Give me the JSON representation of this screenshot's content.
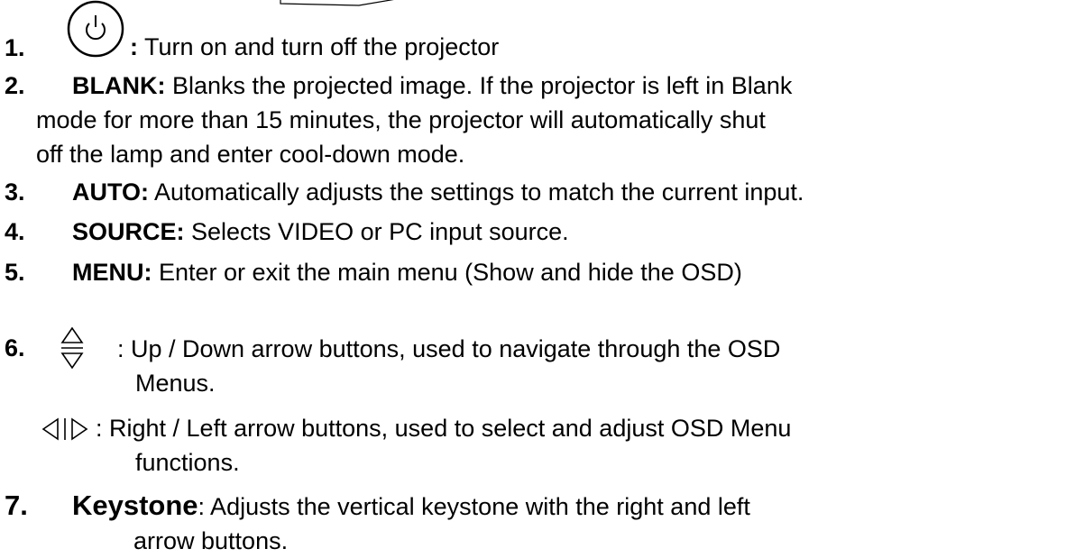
{
  "items": [
    {
      "num": "1.",
      "term": ":",
      "text": " Turn on and turn off the projector",
      "icon": "power-icon"
    },
    {
      "num": "2.",
      "term": "BLANK:",
      "lines": [
        " Blanks the projected image. If the projector is left in Blank",
        "mode for more than 15 minutes, the projector will automatically shut",
        "off the lamp and enter cool-down mode."
      ]
    },
    {
      "num": "3.",
      "term": "AUTO:",
      "text": " Automatically adjusts the settings to match the current input."
    },
    {
      "num": "4.",
      "term": "SOURCE:",
      "text": " Selects VIDEO or PC input source."
    },
    {
      "num": "5.",
      "term": "MENU:",
      "text": " Enter or exit the main menu (Show and hide the OSD)"
    },
    {
      "num": "6.",
      "icon": "up-down-arrow-icon",
      "lines": [
        ": Up / Down arrow buttons, used to navigate through the OSD",
        "Menus."
      ]
    },
    {
      "icon": "left-right-arrow-icon",
      "lines": [
        ": Right / Left arrow buttons, used to select and adjust OSD Menu",
        "functions."
      ]
    },
    {
      "num": "7.",
      "term": "Keystone",
      "lines": [
        ": Adjusts the vertical keystone with the right and left",
        "arrow buttons."
      ]
    }
  ]
}
